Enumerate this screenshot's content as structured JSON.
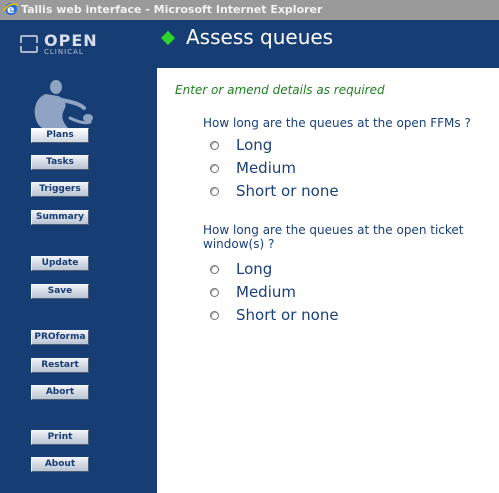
{
  "window": {
    "title": "Tallis web interface - Microsoft Internet Explorer"
  },
  "logo": {
    "line1": "OPEN",
    "line2": "CLINICAL"
  },
  "nav": {
    "plans": "Plans",
    "tasks": "Tasks",
    "triggers": "Triggers",
    "summary": "Summary",
    "update": "Update",
    "save": "Save",
    "proforma": "PROforma",
    "restart": "Restart",
    "abort": "Abort",
    "print": "Print",
    "about": "About"
  },
  "page": {
    "title": "Assess queues",
    "instructions": "Enter or amend details as required"
  },
  "questions": [
    {
      "text": "How long are the queues at the open FFMs ?",
      "options": [
        "Long",
        "Medium",
        "Short or none"
      ]
    },
    {
      "text": "How long are the queues at the open ticket window(s) ?",
      "options": [
        "Long",
        "Medium",
        "Short or none"
      ]
    }
  ],
  "colors": {
    "sidebar": "#173d75",
    "accent": "#2cd52c",
    "instructions": "#1f7f1f",
    "question_text": "#1a3f7a"
  }
}
